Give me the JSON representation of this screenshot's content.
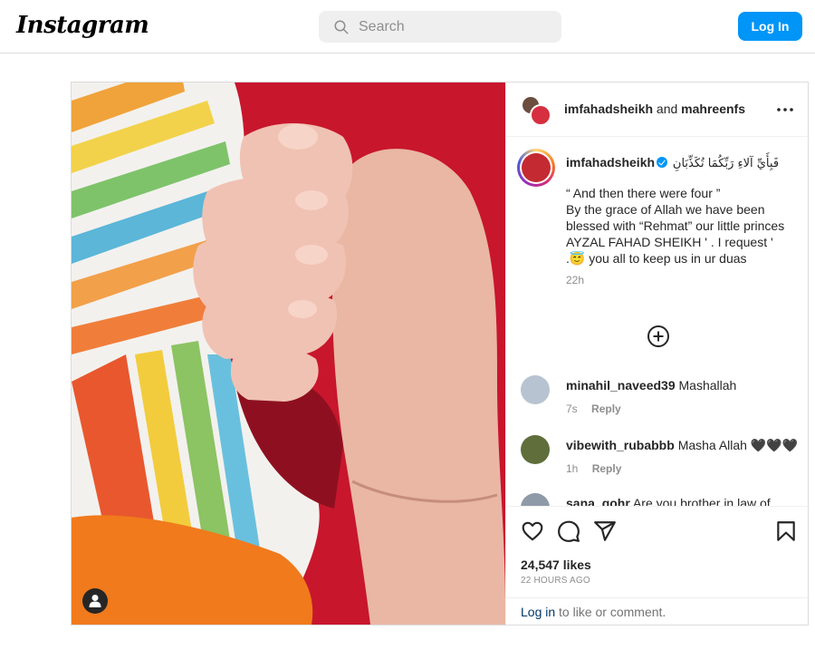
{
  "nav": {
    "logo": "Instagram",
    "search_placeholder": "Search",
    "login_label": "Log In"
  },
  "post": {
    "header": {
      "user1": "imfahadsheikh",
      "joiner": "and",
      "user2": "mahreenfs"
    },
    "caption": {
      "username": "imfahadsheikh",
      "arabic": "فَبِأَيِّ آلاءِ رَبِّكُمَا تُكَذِّبَانِ",
      "body": "“ And then there were four ”\nBy the grace of Allah we have been blessed with “Rehmat” our little princes\nAYZAL FAHAD SHEIKH ' . I request '\n.😇 you all to keep us in ur duas",
      "time": "22h"
    },
    "comments": [
      {
        "username": "minahil_naveed39",
        "text": "Mashallah",
        "time": "7s",
        "reply": "Reply",
        "avatar_color": "#b7c3d1"
      },
      {
        "username": "vibewith_rubabbb",
        "text": "Masha Allah 🖤🖤🖤",
        "time": "1h",
        "reply": "Reply",
        "avatar_color": "#5f6e3b"
      },
      {
        "username": "sana_gohr",
        "text": "Are you brother in law of",
        "avatar_color": "#8f9aa8"
      }
    ],
    "likes": "24,547 likes",
    "posted": "22 HOURS AGO",
    "login_link": "Log in",
    "login_rest": " to like or comment."
  },
  "icons": {
    "search": "search-icon",
    "more": "more-horizontal-icon",
    "load_more": "plus-circle-icon",
    "like": "heart-icon",
    "comment": "comment-icon",
    "share": "paper-plane-icon",
    "save": "bookmark-icon",
    "tag": "user-tag-icon"
  },
  "colors": {
    "accent": "#0095f6",
    "border": "#dbdbdb",
    "muted": "#8e8e8e"
  }
}
